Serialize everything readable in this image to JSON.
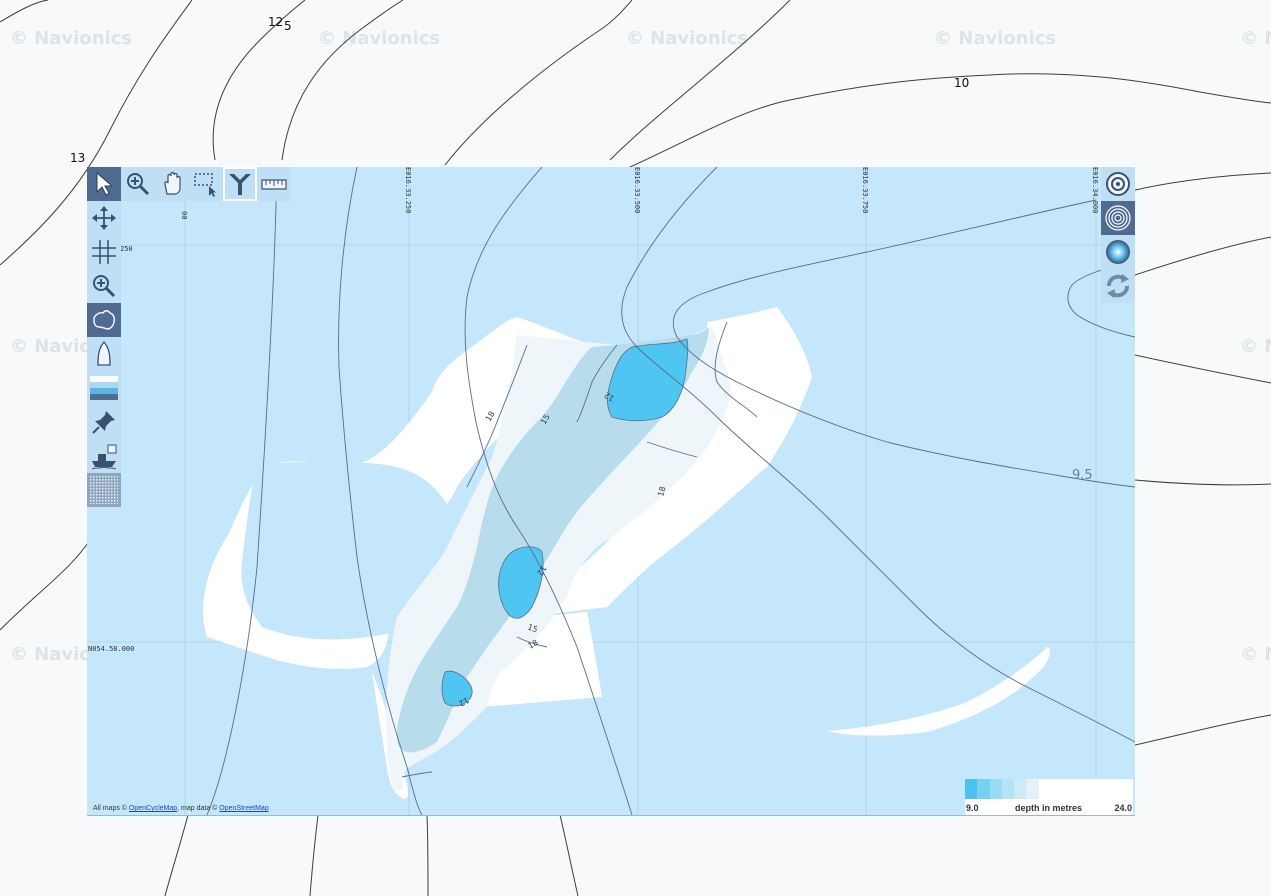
{
  "watermark": "© Navionics",
  "base_depth_labels": [
    "12",
    "5",
    "10",
    "13"
  ],
  "grid": {
    "lon_labels": [
      "00",
      "E016.33.250",
      "E016.33.500",
      "E016.33.750",
      "E016.34.000"
    ],
    "lat_labels": [
      "250",
      "N054.58.000"
    ]
  },
  "overlay_depth_labels": [
    "18",
    "15",
    "12",
    "18",
    "12",
    "15",
    "18",
    "12",
    "9.5"
  ],
  "toolbar_top": [
    {
      "name": "select-arrow-tool",
      "icon": "cursor-arrow-icon",
      "active": true
    },
    {
      "name": "zoom-in-tool",
      "icon": "magnifier-plus-icon",
      "active": false
    },
    {
      "name": "pan-hand-tool",
      "icon": "hand-icon",
      "active": false
    },
    {
      "name": "box-select-tool",
      "icon": "dashed-box-cursor-icon",
      "active": false
    },
    {
      "name": "merge-tool",
      "icon": "funnel-merge-icon",
      "active": false,
      "highlighted": true
    },
    {
      "name": "measure-ruler-tool",
      "icon": "ruler-icon",
      "active": false
    }
  ],
  "toolbar_left": [
    {
      "name": "pan-arrows-tool",
      "icon": "four-arrows-icon",
      "active": false
    },
    {
      "name": "grid-tool",
      "icon": "grid-hash-icon",
      "active": false
    },
    {
      "name": "zoom-tool",
      "icon": "magnifier-plus-icon",
      "active": false
    },
    {
      "name": "outline-layer-tool",
      "icon": "australia-map-icon",
      "active": true
    },
    {
      "name": "boat-tool",
      "icon": "boat-hull-icon",
      "active": false
    },
    {
      "name": "depth-layers-tool",
      "icon": "depth-bands-icon",
      "active": false
    },
    {
      "name": "pin-tool",
      "icon": "pushpin-icon",
      "active": false
    },
    {
      "name": "vessel-survey-tool",
      "icon": "ship-survey-icon",
      "active": false
    },
    {
      "name": "texture-layer-tool",
      "icon": "dither-texture-icon",
      "active": false
    }
  ],
  "toolbar_right": [
    {
      "name": "target-rings-tool",
      "icon": "target-rings-icon",
      "active": false
    },
    {
      "name": "concentric-rings-tool",
      "icon": "concentric-rings-icon",
      "active": true
    },
    {
      "name": "sonar-glow-tool",
      "icon": "glow-circle-icon",
      "active": false
    },
    {
      "name": "refresh-tool",
      "icon": "refresh-arrows-icon",
      "active": false
    }
  ],
  "attribution": {
    "prefix": "All maps ©",
    "link1": "OpenCycleMap",
    "middle": ", map data ©",
    "link2": "OpenStreetMap"
  },
  "legend": {
    "min_label": "9.0",
    "caption": "depth in metres",
    "max_label": "24.0",
    "colors": [
      "#4cc3ef",
      "#76d0f2",
      "#98dbf4",
      "#b4e3f4",
      "#cdebf6",
      "#e2f2f8",
      "#ffffff"
    ]
  },
  "colors": {
    "panel_bg": "#c5e7fb",
    "shallow_white": "#ffffff",
    "shelf_light": "#eef6fa",
    "channel": "#b7dded",
    "deep_pool": "#4ec6f1",
    "toolbar_active": "#4f6b92"
  }
}
